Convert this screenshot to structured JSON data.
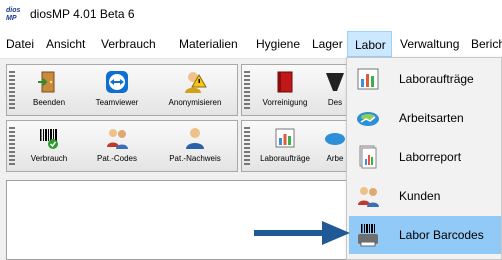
{
  "window": {
    "logo_text": "dios MP",
    "title": "diosMP  4.01 Beta 6"
  },
  "menubar": {
    "items": [
      "Datei",
      "Ansicht",
      "Verbrauch",
      "Materialien",
      "Hygiene",
      "Lager",
      "Labor",
      "Verwaltung",
      "Berich"
    ],
    "active": "Labor"
  },
  "toolbar": {
    "row1": {
      "group1": [
        "Beenden",
        "Teamviewer",
        "Anonymisieren"
      ],
      "group2": [
        "Vorreinigung",
        "Des"
      ]
    },
    "row2": {
      "group1": [
        "Verbrauch",
        "Pat.-Codes",
        "Pat.-Nachweis"
      ],
      "group2": [
        "Laboraufträge",
        "Arbe"
      ]
    }
  },
  "labor_menu": {
    "items": [
      "Laboraufträge",
      "Arbeitsarten",
      "Laborreport",
      "Kunden",
      "Labor Barcodes"
    ],
    "highlighted": "Labor Barcodes"
  },
  "colors": {
    "highlight": "#91c9f7",
    "arrow": "#1f5a96",
    "menu_active": "#cce8ff"
  },
  "icons": [
    "exit-door-icon",
    "teamviewer-icon",
    "anonymize-user-icon",
    "red-book-icon",
    "barcode-scanner-icon",
    "patient-codes-icon",
    "patient-record-icon",
    "chart-report-icon",
    "work-types-icon",
    "lab-report-icon",
    "customers-icon",
    "barcode-printer-icon"
  ]
}
